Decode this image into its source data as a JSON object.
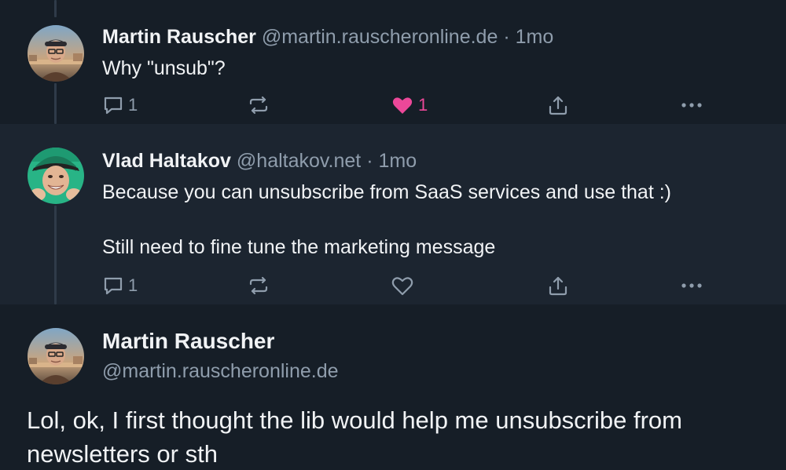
{
  "posts": [
    {
      "author": "Martin Rauscher",
      "handle": "@martin.rauscheronline.de",
      "time": "1mo",
      "text": "Why \"unsub\"?",
      "reply_count": "1",
      "like_count": "1",
      "liked": true,
      "avatar": "photo-man-glasses-cap-harbor"
    },
    {
      "author": "Vlad Haltakov",
      "handle": "@haltakov.net",
      "time": "1mo",
      "text_lines": [
        "Because you can unsubscribe from SaaS services and use that :)",
        "Still need to fine tune the marketing message"
      ],
      "reply_count": "1",
      "like_count": "",
      "liked": false,
      "avatar": "photo-man-green-cap-smiling"
    }
  ],
  "main_post": {
    "author": "Martin Rauscher",
    "handle": "@martin.rauscheronline.de",
    "text": "Lol, ok, I first thought the lib would help me unsubscribe from newsletters or sth",
    "avatar": "photo-man-glasses-cap-harbor"
  },
  "separator": "·",
  "icons": {
    "reply": "reply-icon",
    "repost": "repost-icon",
    "like": "heart-icon",
    "share": "share-icon",
    "more": "more-icon"
  },
  "colors": {
    "background": "#161e27",
    "highlight_background": "#1c2530",
    "text": "#f1f3f5",
    "muted": "#8f9dac",
    "like_active": "#ec4899",
    "thread_line": "#2f3b49"
  }
}
